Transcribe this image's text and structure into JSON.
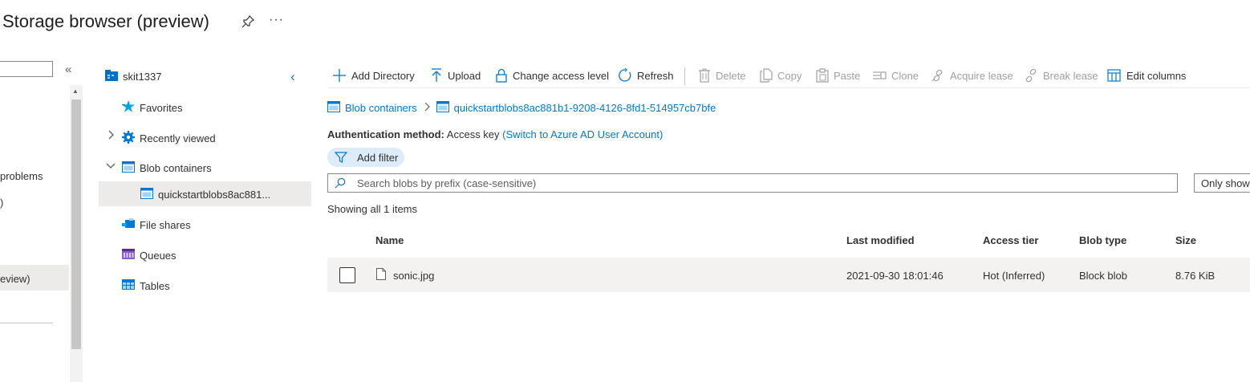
{
  "header": {
    "title": "Storage browser (preview)",
    "more_label": "···"
  },
  "left_nav": {
    "items": [
      "problems",
      ")",
      "eview)"
    ]
  },
  "tree": {
    "account": "skit1337",
    "items": {
      "favorites": "Favorites",
      "recently_viewed": "Recently viewed",
      "blob_containers": "Blob containers",
      "container": "quickstartblobs8ac881...",
      "file_shares": "File shares",
      "queues": "Queues",
      "tables": "Tables"
    }
  },
  "toolbar": {
    "add_directory": "Add Directory",
    "upload": "Upload",
    "change_access_level": "Change access level",
    "refresh": "Refresh",
    "delete": "Delete",
    "copy": "Copy",
    "paste": "Paste",
    "clone": "Clone",
    "acquire_lease": "Acquire lease",
    "break_lease": "Break lease",
    "edit_columns": "Edit columns"
  },
  "breadcrumb": {
    "root": "Blob containers",
    "separator": ">",
    "current": "quickstartblobs8ac881b1-9208-4126-8fd1-514957cb7bfe"
  },
  "auth": {
    "label": "Authentication method:",
    "value": "Access key",
    "switch_link": "(Switch to Azure AD User Account)"
  },
  "filter": {
    "add_filter": "Add filter"
  },
  "search": {
    "placeholder": "Search blobs by prefix (case-sensitive)"
  },
  "only_show": "Only show",
  "status": "Showing all 1 items",
  "table": {
    "columns": {
      "name": "Name",
      "last_modified": "Last modified",
      "access_tier": "Access tier",
      "blob_type": "Blob type",
      "size": "Size"
    },
    "rows": [
      {
        "name": "sonic.jpg",
        "last_modified": "2021-09-30 18:01:46",
        "access_tier": "Hot (Inferred)",
        "blob_type": "Block blob",
        "size": "8.76 KiB"
      }
    ]
  },
  "colors": {
    "accent": "#0078d4",
    "disabled_text": "#a19f9d",
    "selected_bg": "#edebe9",
    "row_bg": "#f3f2f1",
    "filter_pill_bg": "#deecf9"
  },
  "icons": {
    "pin": "pin-icon",
    "account": "storage-account-icon",
    "favorites": "star-icon",
    "recently_viewed": "gear-icon",
    "container": "container-icon",
    "file_shares": "file-share-icon",
    "queues": "queue-icon",
    "tables": "table-icon",
    "file": "document-icon"
  }
}
